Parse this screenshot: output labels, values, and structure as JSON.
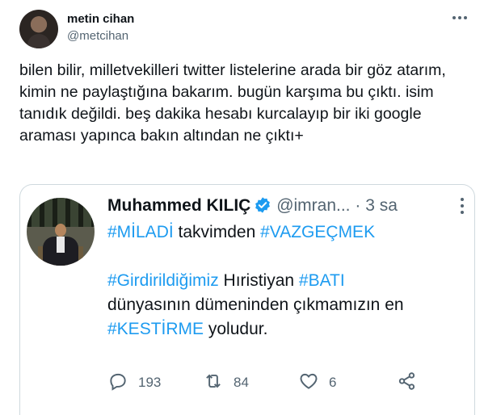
{
  "tweet": {
    "author_name": "metin cihan",
    "author_handle": "@metcihan",
    "text": "bilen bilir, milletvekilleri twitter listelerine arada bir göz atarım, kimin ne paylaştığına bakarım. bugün karşıma bu çıktı. isim tanıdık değildi. beş dakika hesabı kurcalayıp bir iki google araması yapınca bakın altından ne çıktı+",
    "more_icon": "more-horizontal-icon"
  },
  "quoted": {
    "author_name": "Muhammed KILIÇ",
    "author_handle": "@imran...",
    "dot": "·",
    "time": "3 sa",
    "line1_tag1": "#MİLADİ",
    "line1_text": " takvimden ",
    "line1_tag2": "#VAZGEÇMEK",
    "line2_tag": "#Girdirildiğimiz",
    "line2_text": " Hıristiyan ",
    "line2_tag2": "#BATI",
    "line3_text": "dünyasının dümeninden çıkmamızın en",
    "line4_tag": "#KESTİRME",
    "line4_text": " yoludur.",
    "verified_color": "#1d9bf0",
    "link_color": "#1d9bf0",
    "actions": {
      "replies": "193",
      "retweets": "84",
      "likes": "6"
    }
  }
}
